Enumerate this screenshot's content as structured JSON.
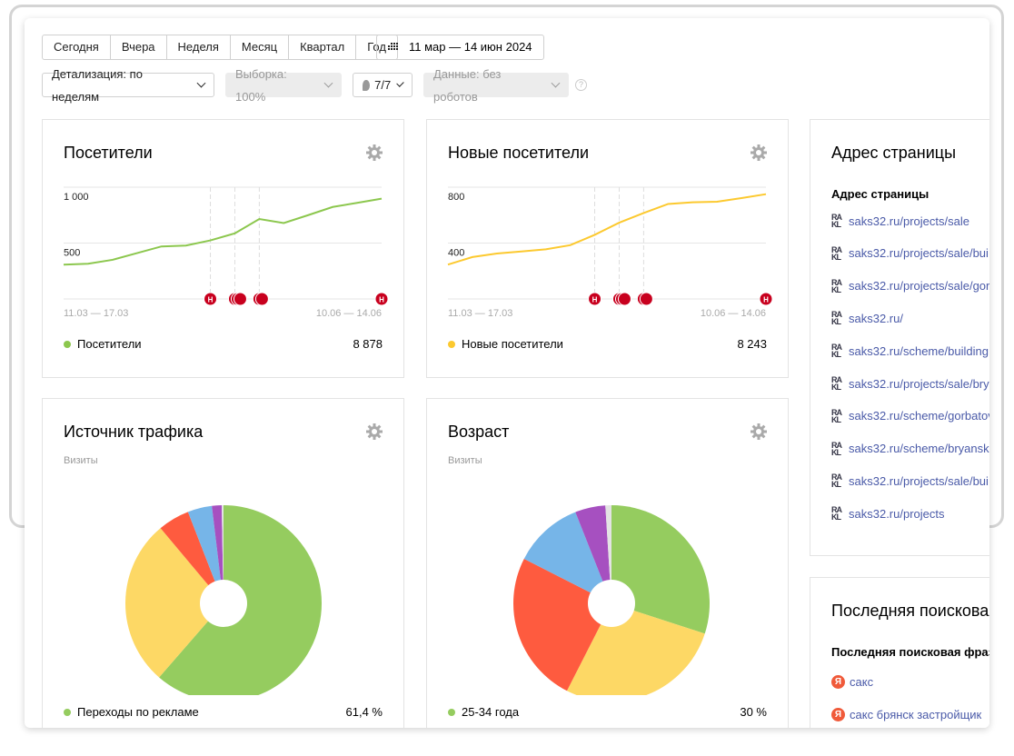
{
  "toolbar": {
    "periods": [
      "Сегодня",
      "Вчера",
      "Неделя",
      "Месяц",
      "Квартал",
      "Год"
    ],
    "date_range": "11 мар — 14 июн 2024",
    "detail": "Детализация: по неделям",
    "sample": "Выборка: 100%",
    "segments": "7/7",
    "data_filter": "Данные: без роботов",
    "help": "?"
  },
  "cards": {
    "visitors": {
      "title": "Посетители",
      "legend": "Посетители",
      "total": "8 878",
      "color": "#8cc74e"
    },
    "new_visitors": {
      "title": "Новые посетители",
      "legend": "Новые посетители",
      "total": "8 243",
      "color": "#fcc92f"
    },
    "traffic": {
      "title": "Источник трафика",
      "subtitle": "Визиты",
      "legend": "Переходы по рекламе",
      "value": "61,4 %"
    },
    "age": {
      "title": "Возраст",
      "subtitle": "Визиты",
      "legend": "25-34 года",
      "value": "30 %"
    },
    "pages": {
      "title": "Адрес страницы",
      "column": "Адрес страницы",
      "items": [
        "saks32.ru/projects/sale",
        "saks32.ru/projects/sale/bui",
        "saks32.ru/projects/sale/gor",
        "saks32.ru/",
        "saks32.ru/scheme/building",
        "saks32.ru/projects/sale/bry",
        "saks32.ru/scheme/gorbatov",
        "saks32.ru/scheme/bryansk",
        "saks32.ru/projects/sale/bui",
        "saks32.ru/projects"
      ]
    },
    "search": {
      "title": "Последняя поисковая фраза",
      "column": "Последняя поисковая фраза",
      "items": [
        "сакс",
        "сакс брянск застройщик"
      ]
    }
  },
  "chart_data": [
    {
      "type": "line",
      "name": "visitors",
      "ylim": [
        0,
        1000
      ],
      "yticks": [
        "1 000",
        "500"
      ],
      "ytick_values": [
        1000,
        500
      ],
      "xlabels": [
        "11.03 — 17.03",
        "10.06 — 14.06"
      ],
      "values": [
        307,
        315,
        350,
        410,
        470,
        478,
        524,
        587,
        715,
        679,
        750,
        823,
        860,
        897
      ],
      "color": "#8cc74e",
      "annotation_weeks": [
        6,
        7,
        7,
        7,
        8,
        8,
        13
      ],
      "annotation_label": "Н",
      "grid": true
    },
    {
      "type": "line",
      "name": "new_visitors",
      "ylim": [
        0,
        800
      ],
      "yticks": [
        "800",
        "400"
      ],
      "ytick_values": [
        800,
        400
      ],
      "xlabels": [
        "11.03 — 17.03",
        "10.06 — 14.06"
      ],
      "values": [
        246,
        300,
        325,
        340,
        355,
        385,
        459,
        546,
        615,
        680,
        692,
        696,
        722,
        750
      ],
      "color": "#fcc92f",
      "annotation_weeks": [
        6,
        7,
        7,
        7,
        8,
        8,
        13
      ],
      "annotation_label": "Н",
      "grid": true
    },
    {
      "type": "pie",
      "name": "traffic",
      "values": [
        61.4,
        27.5,
        5.2,
        4.0,
        1.6,
        0.3
      ],
      "colors": [
        "#95cc5f",
        "#fdd865",
        "#fe5b3f",
        "#76b5e8",
        "#a650c0",
        "#e3e3e3"
      ]
    },
    {
      "type": "pie",
      "name": "age",
      "values": [
        30,
        27.5,
        25,
        11.5,
        5,
        1
      ],
      "colors": [
        "#95cc5f",
        "#fdd865",
        "#fe5b3f",
        "#76b5e8",
        "#a650c0",
        "#e3e3e3"
      ]
    }
  ]
}
